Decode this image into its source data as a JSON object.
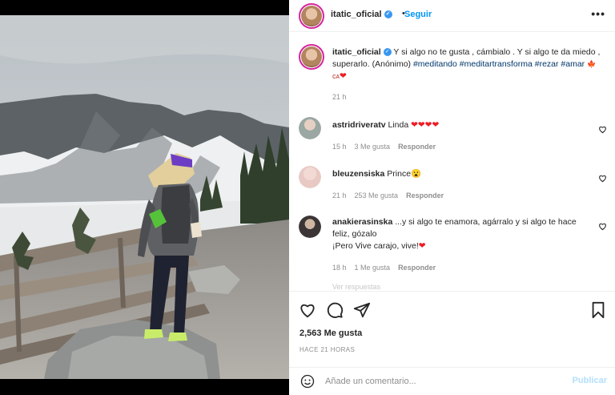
{
  "header": {
    "username": "itatic_oficial",
    "separator": "•",
    "follow_label": "Seguir",
    "more_label": "•••"
  },
  "caption": {
    "username": "itatic_oficial",
    "text": " Y si algo no te gusta , cámbialo . Y si algo te da miedo , superarlo. (Anónimo) ",
    "hashtags": [
      "#meditando",
      "#meditartransforma",
      "#rezar",
      "#amar"
    ],
    "emoji_suffix": "🍁ᴄᴀ",
    "heart": "❤",
    "time": "21 h"
  },
  "comments": [
    {
      "username": "astridriveratv",
      "text": " Linda ",
      "hearts": "❤❤❤❤",
      "time": "15 h",
      "likes": "3 Me gusta",
      "reply": "Responder",
      "avatar_color": "#9aa7a3"
    },
    {
      "username": "bleuzensiska",
      "text": " Prince",
      "emoji": "😮",
      "time": "21 h",
      "likes": "253 Me gusta",
      "reply": "Responder",
      "avatar_color": "#e8c9c4"
    },
    {
      "username": "anakierasinska",
      "text": " ...y si algo te enamora, agárralo y si algo te hace feliz, gózalo",
      "text2": "¡Pero Vive carajo, vive!",
      "heart": "❤",
      "time": "18 h",
      "likes": "1 Me gusta",
      "reply": "Responder",
      "avatar_color": "#3b3535"
    }
  ],
  "hidden_row": "Ver respuestas",
  "actions": {
    "likes": "2,563 Me gusta",
    "posted": "HACE 21 HORAS"
  },
  "composer": {
    "placeholder": "Añade un comentario...",
    "publish_label": "Publicar"
  },
  "icons": {
    "verified": "verified-badge-icon",
    "like": "heart-icon",
    "comment": "comment-icon",
    "share": "paper-plane-icon",
    "save": "bookmark-icon",
    "emoji": "smiley-icon"
  },
  "colors": {
    "accent": "#0095f6",
    "publish_disabled": "#b2dffc",
    "verified": "#3897f0",
    "hashtag": "#00376b"
  }
}
